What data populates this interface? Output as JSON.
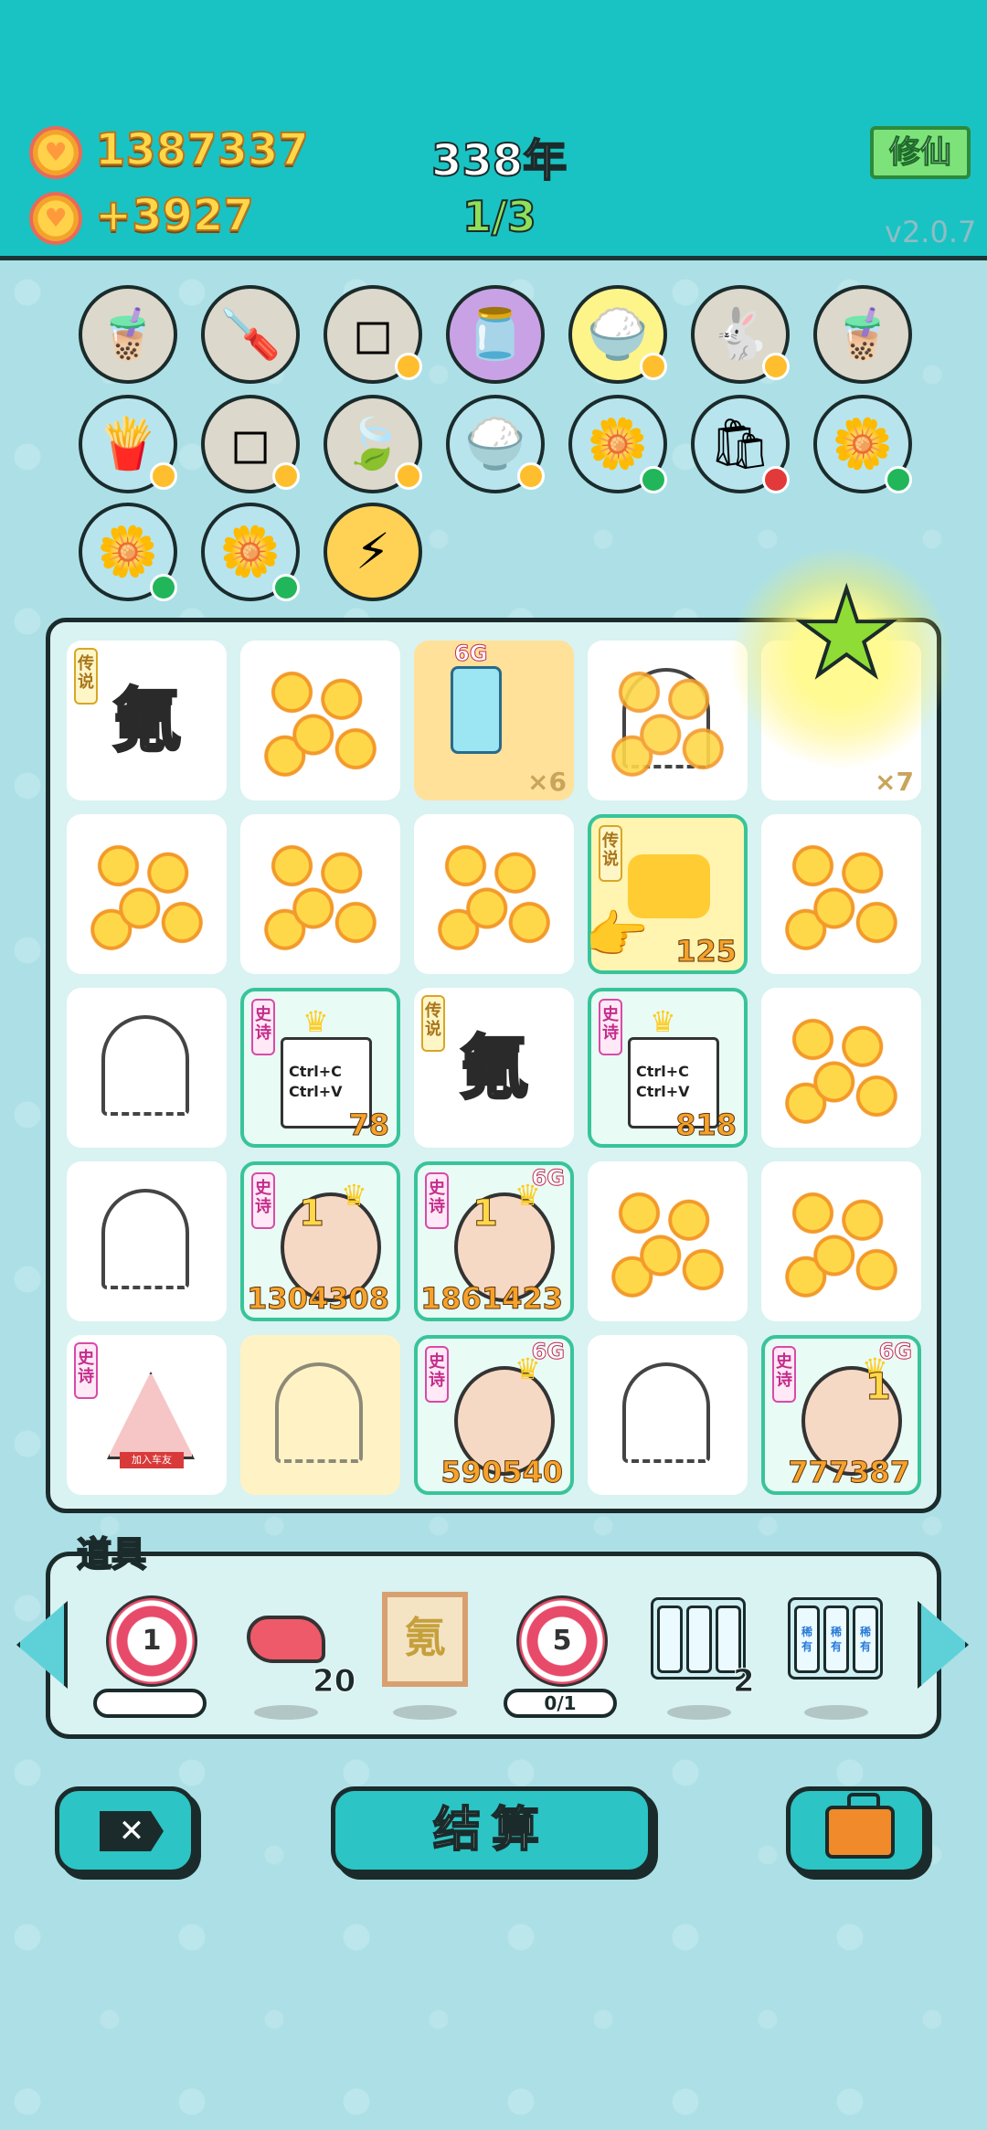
{
  "header": {
    "coins": "1387337",
    "coin_rate": "+3927",
    "years": "338年",
    "progress": "1/3",
    "cultivate_button": "修仙",
    "version": "v2.0.7"
  },
  "items": [
    {
      "name": "milk-tea",
      "icon": "🧋"
    },
    {
      "name": "screwdriver",
      "icon": "🪛"
    },
    {
      "name": "sugar-cubes",
      "icon": "◻"
    },
    {
      "name": "jar",
      "icon": "🫙"
    },
    {
      "name": "rice-bowl",
      "icon": "🍚"
    },
    {
      "name": "rabbit",
      "icon": "🐇"
    },
    {
      "name": "milk-tea",
      "icon": "🧋"
    },
    {
      "name": "fries",
      "icon": "🍟"
    },
    {
      "name": "sugar-cubes",
      "icon": "◻"
    },
    {
      "name": "leaf",
      "icon": "🍃"
    },
    {
      "name": "rice-bowl",
      "icon": "🍚"
    },
    {
      "name": "flower-pot",
      "icon": "🌼"
    },
    {
      "name": "trash-bag",
      "icon": "🛍"
    },
    {
      "name": "flower-pot",
      "icon": "🌼"
    },
    {
      "name": "flower-pot",
      "icon": "🌼"
    },
    {
      "name": "flower-pot",
      "icon": "🌼"
    },
    {
      "name": "lightning",
      "icon": "⚡"
    }
  ],
  "grid": {
    "tags": {
      "legend": "传说",
      "epic": "史诗"
    },
    "cells": [
      {
        "big_char": "氪"
      },
      {
        "badge": "6G",
        "mult": "×6"
      },
      {
        "mult": "×7"
      },
      {
        "count": "125"
      },
      {
        "ctrl_text": "Ctrl+C Ctrl+V",
        "count": "78"
      },
      {
        "big_char": "氪"
      },
      {
        "ctrl_text": "Ctrl+C Ctrl+V",
        "count": "818"
      },
      {
        "count": "1304308",
        "level": "1"
      },
      {
        "count": "1861423",
        "level": "1",
        "badge": "6G"
      },
      {
        "sign": "加入车友"
      },
      {
        "count": "590540",
        "badge": "6G"
      },
      {
        "count": "777387",
        "level": "1",
        "badge": "6G"
      }
    ]
  },
  "tools": {
    "title": "道具",
    "target1_num": "1",
    "liver_count": "20",
    "kettle_char": "氪",
    "target5_num": "5",
    "target5_progress": "0/1",
    "slots_count": "2",
    "slot_label": "稀有"
  },
  "buttons": {
    "settle": "结算"
  },
  "colors": {
    "header_bg": "#19c3c3",
    "page_bg": "#ace0e6",
    "gold": "#ffd84a",
    "green": "#8ee05a",
    "teal_button": "#2cc4c4"
  }
}
